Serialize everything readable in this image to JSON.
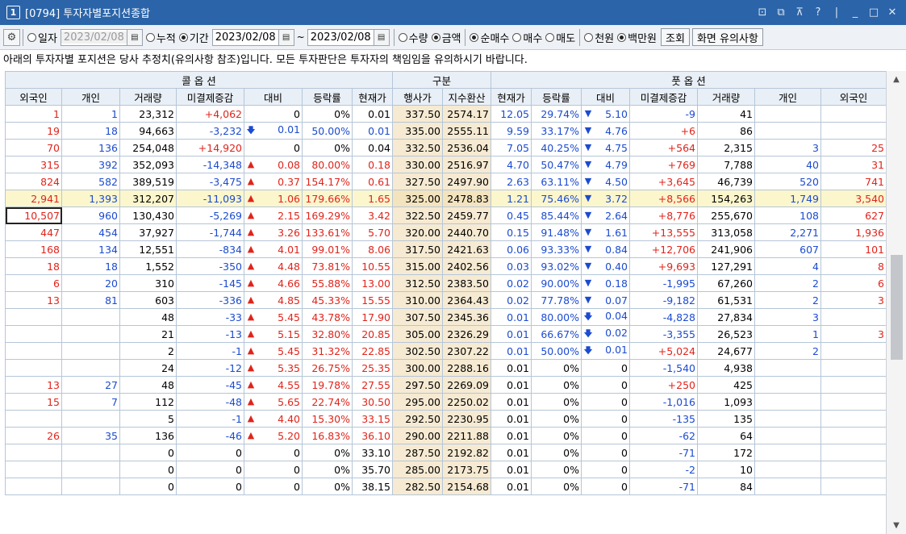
{
  "window": {
    "number": "1",
    "title": "[0794] 투자자별포지션종합"
  },
  "toolbar": {
    "daily_label": "일자",
    "daily_date": "2023/02/08",
    "cumulative_label": "누적",
    "period_label": "기간",
    "period_from": "2023/02/08",
    "period_sep": "~",
    "period_to": "2023/02/08",
    "qty_label": "수량",
    "amount_label": "금액",
    "net_buy_label": "순매수",
    "buy_label": "매수",
    "sell_label": "매도",
    "thousand_label": "천원",
    "million_label": "백만원",
    "query_button": "조회",
    "notes_button": "화면 유의사항"
  },
  "notice": "아래의 투자자별 포지션은 당사 추정치(유의사항 참조)입니다. 모든 투자판단은 투자자의 책임임을 유의하시기 바랍니다.",
  "table": {
    "group_call": "콜 옵 션",
    "group_mid": "구분",
    "group_put": "풋 옵 션",
    "headers": [
      "외국인",
      "개인",
      "거래량",
      "미결제증감",
      "대비",
      "등락률",
      "현재가",
      "행사가",
      "지수환산",
      "현재가",
      "등락률",
      "대비",
      "미결제증감",
      "거래량",
      "개인",
      "외국인"
    ],
    "rows": [
      {
        "c_for": "1",
        "c_ind": "1",
        "c_vol": "23,312",
        "c_oi": "+4,062",
        "c_dir": "",
        "c_chg": "0",
        "c_rate": "0%",
        "c_px": "0.01",
        "strike": "337.50",
        "idx": "2574.17",
        "p_px": "12.05",
        "p_rate": "29.74%",
        "p_dir": "down",
        "p_chg": "5.10",
        "p_oi": "-9",
        "p_vol": "41",
        "p_ind": "",
        "p_for": ""
      },
      {
        "c_for": "19",
        "c_ind": "18",
        "c_vol": "94,663",
        "c_oi": "-3,232",
        "c_dir": "downb",
        "c_chg": "0.01",
        "c_rate": "50.00%",
        "c_px": "0.01",
        "strike": "335.00",
        "idx": "2555.11",
        "p_px": "9.59",
        "p_rate": "33.17%",
        "p_dir": "down",
        "p_chg": "4.76",
        "p_oi": "+6",
        "p_vol": "86",
        "p_ind": "",
        "p_for": ""
      },
      {
        "c_for": "70",
        "c_ind": "136",
        "c_vol": "254,048",
        "c_oi": "+14,920",
        "c_dir": "",
        "c_chg": "0",
        "c_rate": "0%",
        "c_px": "0.04",
        "strike": "332.50",
        "idx": "2536.04",
        "p_px": "7.05",
        "p_rate": "40.25%",
        "p_dir": "down",
        "p_chg": "4.75",
        "p_oi": "+564",
        "p_vol": "2,315",
        "p_ind": "3",
        "p_for": "25"
      },
      {
        "c_for": "315",
        "c_ind": "392",
        "c_vol": "352,093",
        "c_oi": "-14,348",
        "c_dir": "up",
        "c_chg": "0.08",
        "c_rate": "80.00%",
        "c_px": "0.18",
        "strike": "330.00",
        "idx": "2516.97",
        "p_px": "4.70",
        "p_rate": "50.47%",
        "p_dir": "down",
        "p_chg": "4.79",
        "p_oi": "+769",
        "p_vol": "7,788",
        "p_ind": "40",
        "p_for": "31"
      },
      {
        "c_for": "824",
        "c_ind": "582",
        "c_vol": "389,519",
        "c_oi": "-3,475",
        "c_dir": "up",
        "c_chg": "0.37",
        "c_rate": "154.17%",
        "c_px": "0.61",
        "strike": "327.50",
        "idx": "2497.90",
        "p_px": "2.63",
        "p_rate": "63.11%",
        "p_dir": "down",
        "p_chg": "4.50",
        "p_oi": "+3,645",
        "p_vol": "46,739",
        "p_ind": "520",
        "p_for": "741"
      },
      {
        "c_for": "2,941",
        "c_ind": "1,393",
        "c_vol": "312,207",
        "c_oi": "-11,093",
        "c_dir": "up",
        "c_chg": "1.06",
        "c_rate": "179.66%",
        "c_px": "1.65",
        "strike": "325.00",
        "idx": "2478.83",
        "p_px": "1.21",
        "p_rate": "75.46%",
        "p_dir": "down",
        "p_chg": "3.72",
        "p_oi": "+8,566",
        "p_vol": "154,263",
        "p_ind": "1,749",
        "p_for": "3,540"
      },
      {
        "c_for": "10,507",
        "c_ind": "960",
        "c_vol": "130,430",
        "c_oi": "-5,269",
        "c_dir": "up",
        "c_chg": "2.15",
        "c_rate": "169.29%",
        "c_px": "3.42",
        "strike": "322.50",
        "idx": "2459.77",
        "p_px": "0.45",
        "p_rate": "85.44%",
        "p_dir": "down",
        "p_chg": "2.64",
        "p_oi": "+8,776",
        "p_vol": "255,670",
        "p_ind": "108",
        "p_for": "627"
      },
      {
        "c_for": "447",
        "c_ind": "454",
        "c_vol": "37,927",
        "c_oi": "-1,744",
        "c_dir": "up",
        "c_chg": "3.26",
        "c_rate": "133.61%",
        "c_px": "5.70",
        "strike": "320.00",
        "idx": "2440.70",
        "p_px": "0.15",
        "p_rate": "91.48%",
        "p_dir": "down",
        "p_chg": "1.61",
        "p_oi": "+13,555",
        "p_vol": "313,058",
        "p_ind": "2,271",
        "p_for": "1,936"
      },
      {
        "c_for": "168",
        "c_ind": "134",
        "c_vol": "12,551",
        "c_oi": "-834",
        "c_dir": "up",
        "c_chg": "4.01",
        "c_rate": "99.01%",
        "c_px": "8.06",
        "strike": "317.50",
        "idx": "2421.63",
        "p_px": "0.06",
        "p_rate": "93.33%",
        "p_dir": "down",
        "p_chg": "0.84",
        "p_oi": "+12,706",
        "p_vol": "241,906",
        "p_ind": "607",
        "p_for": "101"
      },
      {
        "c_for": "18",
        "c_ind": "18",
        "c_vol": "1,552",
        "c_oi": "-350",
        "c_dir": "up",
        "c_chg": "4.48",
        "c_rate": "73.81%",
        "c_px": "10.55",
        "strike": "315.00",
        "idx": "2402.56",
        "p_px": "0.03",
        "p_rate": "93.02%",
        "p_dir": "down",
        "p_chg": "0.40",
        "p_oi": "+9,693",
        "p_vol": "127,291",
        "p_ind": "4",
        "p_for": "8"
      },
      {
        "c_for": "6",
        "c_ind": "20",
        "c_vol": "310",
        "c_oi": "-145",
        "c_dir": "up",
        "c_chg": "4.66",
        "c_rate": "55.88%",
        "c_px": "13.00",
        "strike": "312.50",
        "idx": "2383.50",
        "p_px": "0.02",
        "p_rate": "90.00%",
        "p_dir": "down",
        "p_chg": "0.18",
        "p_oi": "-1,995",
        "p_vol": "67,260",
        "p_ind": "2",
        "p_for": "6"
      },
      {
        "c_for": "13",
        "c_ind": "81",
        "c_vol": "603",
        "c_oi": "-336",
        "c_dir": "up",
        "c_chg": "4.85",
        "c_rate": "45.33%",
        "c_px": "15.55",
        "strike": "310.00",
        "idx": "2364.43",
        "p_px": "0.02",
        "p_rate": "77.78%",
        "p_dir": "down",
        "p_chg": "0.07",
        "p_oi": "-9,182",
        "p_vol": "61,531",
        "p_ind": "2",
        "p_for": "3"
      },
      {
        "c_for": "",
        "c_ind": "",
        "c_vol": "48",
        "c_oi": "-33",
        "c_dir": "up",
        "c_chg": "5.45",
        "c_rate": "43.78%",
        "c_px": "17.90",
        "strike": "307.50",
        "idx": "2345.36",
        "p_px": "0.01",
        "p_rate": "80.00%",
        "p_dir": "downb",
        "p_chg": "0.04",
        "p_oi": "-4,828",
        "p_vol": "27,834",
        "p_ind": "3",
        "p_for": ""
      },
      {
        "c_for": "",
        "c_ind": "",
        "c_vol": "21",
        "c_oi": "-13",
        "c_dir": "up",
        "c_chg": "5.15",
        "c_rate": "32.80%",
        "c_px": "20.85",
        "strike": "305.00",
        "idx": "2326.29",
        "p_px": "0.01",
        "p_rate": "66.67%",
        "p_dir": "downb",
        "p_chg": "0.02",
        "p_oi": "-3,355",
        "p_vol": "26,523",
        "p_ind": "1",
        "p_for": "3"
      },
      {
        "c_for": "",
        "c_ind": "",
        "c_vol": "2",
        "c_oi": "-1",
        "c_dir": "up",
        "c_chg": "5.45",
        "c_rate": "31.32%",
        "c_px": "22.85",
        "strike": "302.50",
        "idx": "2307.22",
        "p_px": "0.01",
        "p_rate": "50.00%",
        "p_dir": "downb",
        "p_chg": "0.01",
        "p_oi": "+5,024",
        "p_vol": "24,677",
        "p_ind": "2",
        "p_for": ""
      },
      {
        "c_for": "",
        "c_ind": "",
        "c_vol": "24",
        "c_oi": "-12",
        "c_dir": "up",
        "c_chg": "5.35",
        "c_rate": "26.75%",
        "c_px": "25.35",
        "strike": "300.00",
        "idx": "2288.16",
        "p_px": "0.01",
        "p_rate": "0%",
        "p_dir": "",
        "p_chg": "0",
        "p_oi": "-1,540",
        "p_vol": "4,938",
        "p_ind": "",
        "p_for": ""
      },
      {
        "c_for": "13",
        "c_ind": "27",
        "c_vol": "48",
        "c_oi": "-45",
        "c_dir": "up",
        "c_chg": "4.55",
        "c_rate": "19.78%",
        "c_px": "27.55",
        "strike": "297.50",
        "idx": "2269.09",
        "p_px": "0.01",
        "p_rate": "0%",
        "p_dir": "",
        "p_chg": "0",
        "p_oi": "+250",
        "p_vol": "425",
        "p_ind": "",
        "p_for": ""
      },
      {
        "c_for": "15",
        "c_ind": "7",
        "c_vol": "112",
        "c_oi": "-48",
        "c_dir": "up",
        "c_chg": "5.65",
        "c_rate": "22.74%",
        "c_px": "30.50",
        "strike": "295.00",
        "idx": "2250.02",
        "p_px": "0.01",
        "p_rate": "0%",
        "p_dir": "",
        "p_chg": "0",
        "p_oi": "-1,016",
        "p_vol": "1,093",
        "p_ind": "",
        "p_for": ""
      },
      {
        "c_for": "",
        "c_ind": "",
        "c_vol": "5",
        "c_oi": "-1",
        "c_dir": "up",
        "c_chg": "4.40",
        "c_rate": "15.30%",
        "c_px": "33.15",
        "strike": "292.50",
        "idx": "2230.95",
        "p_px": "0.01",
        "p_rate": "0%",
        "p_dir": "",
        "p_chg": "0",
        "p_oi": "-135",
        "p_vol": "135",
        "p_ind": "",
        "p_for": ""
      },
      {
        "c_for": "26",
        "c_ind": "35",
        "c_vol": "136",
        "c_oi": "-46",
        "c_dir": "up",
        "c_chg": "5.20",
        "c_rate": "16.83%",
        "c_px": "36.10",
        "strike": "290.00",
        "idx": "2211.88",
        "p_px": "0.01",
        "p_rate": "0%",
        "p_dir": "",
        "p_chg": "0",
        "p_oi": "-62",
        "p_vol": "64",
        "p_ind": "",
        "p_for": ""
      },
      {
        "c_for": "",
        "c_ind": "",
        "c_vol": "0",
        "c_oi": "0",
        "c_dir": "",
        "c_chg": "0",
        "c_rate": "0%",
        "c_px": "33.10",
        "strike": "287.50",
        "idx": "2192.82",
        "p_px": "0.01",
        "p_rate": "0%",
        "p_dir": "",
        "p_chg": "0",
        "p_oi": "-71",
        "p_vol": "172",
        "p_ind": "",
        "p_for": ""
      },
      {
        "c_for": "",
        "c_ind": "",
        "c_vol": "0",
        "c_oi": "0",
        "c_dir": "",
        "c_chg": "0",
        "c_rate": "0%",
        "c_px": "35.70",
        "strike": "285.00",
        "idx": "2173.75",
        "p_px": "0.01",
        "p_rate": "0%",
        "p_dir": "",
        "p_chg": "0",
        "p_oi": "-2",
        "p_vol": "10",
        "p_ind": "",
        "p_for": ""
      },
      {
        "c_for": "",
        "c_ind": "",
        "c_vol": "0",
        "c_oi": "0",
        "c_dir": "",
        "c_chg": "0",
        "c_rate": "0%",
        "c_px": "38.15",
        "strike": "282.50",
        "idx": "2154.68",
        "p_px": "0.01",
        "p_rate": "0%",
        "p_dir": "",
        "p_chg": "0",
        "p_oi": "-71",
        "p_vol": "84",
        "p_ind": "",
        "p_for": ""
      }
    ],
    "highlight_row": 5,
    "selected_row": 6
  },
  "colors": {
    "titlebar": "#2b64a8",
    "positive": "#e0241b",
    "negative": "#1b4bd1",
    "strike_bg": "#f6ead2",
    "highlight_bg": "#fbf6cc"
  }
}
